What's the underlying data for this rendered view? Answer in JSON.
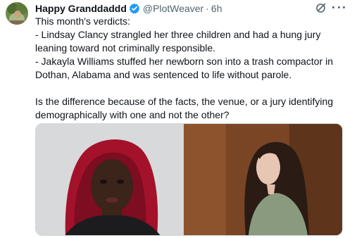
{
  "tweet": {
    "author_name": "Happy Granddaddd",
    "handle": "@PlotWeaver",
    "separator": "·",
    "time": "6h",
    "lines": [
      "This month's verdicts:",
      "- Lindsay Clancy strangled her three children and had a hung jury leaning toward not criminally responsible.",
      "- Jakayla Williams stuffed her newborn son into a trash compactor in Dothan, Alabama and was sentenced to life without parole."
    ],
    "question": "Is the difference because of the facts, the venue, or a jury identifying demographically with one and not the other?"
  },
  "icons": {
    "avatar": "avatar-image",
    "verified": "verified-badge-icon",
    "grok": "grok-icon",
    "more": "more-options-icon"
  },
  "colors": {
    "text": "#0f1419",
    "secondary": "#536471",
    "verified_blue": "#1d9bf0",
    "border": "#cfd9de"
  }
}
